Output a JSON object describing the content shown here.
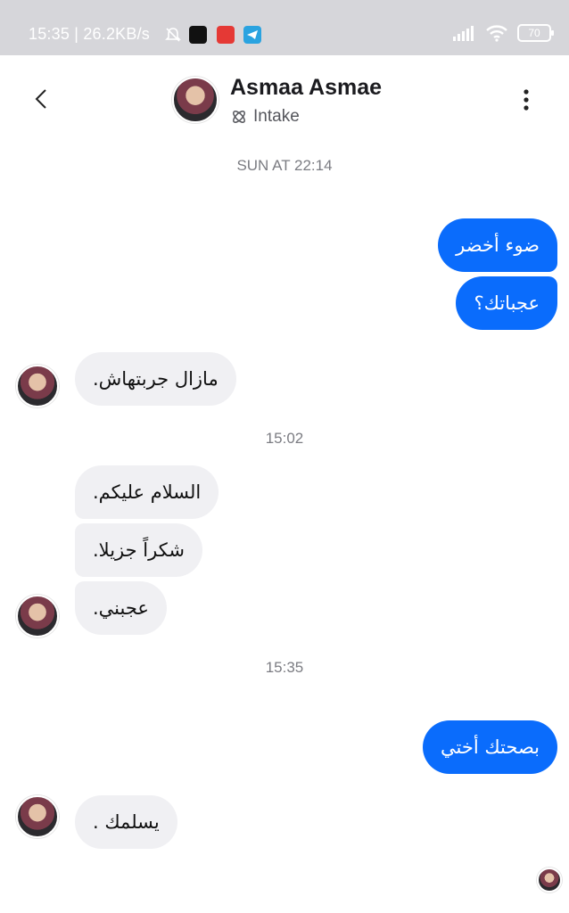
{
  "status_bar": {
    "text": "15:35 | 26.2KB/s",
    "battery": "70"
  },
  "header": {
    "name": "Asmaa Asmae",
    "subtitle": "Intake"
  },
  "timestamps": [
    "SUN AT 22:14",
    "15:02",
    "15:35"
  ],
  "messages": [
    {
      "dir": "out",
      "text": "ضوء أخضر"
    },
    {
      "dir": "out",
      "text": "عجباتك؟"
    },
    {
      "dir": "in",
      "text": "مازال جربتهاش."
    },
    {
      "dir": "in",
      "text": "السلام عليكم."
    },
    {
      "dir": "in",
      "text": "شكراً جزيلا."
    },
    {
      "dir": "in",
      "text": "عجبني."
    },
    {
      "dir": "out",
      "text": "بصحتك أختي"
    },
    {
      "dir": "in",
      "text": "يسلمك ."
    }
  ],
  "colors": {
    "outgoing_bubble": "#0a6cfc",
    "incoming_bubble": "#f0f0f3",
    "status_bar": "#d6d6da"
  },
  "icons": [
    "mute-icon",
    "capcut-icon",
    "pdf-icon",
    "telegram-icon",
    "signal-icon",
    "wifi-icon",
    "battery-icon",
    "back-icon",
    "intake-icon",
    "more-icon"
  ]
}
